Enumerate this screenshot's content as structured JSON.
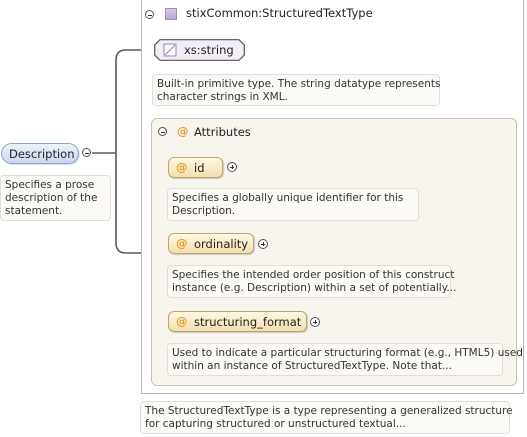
{
  "element": {
    "name": "Description",
    "doc_lines": [
      "Specifies a prose",
      "description of the",
      "statement."
    ]
  },
  "complex_type": {
    "name": "stixCommon:StructuredTextType",
    "doc_lines": [
      "The StructuredTextType is a type representing a generalized structure",
      "for capturing structured or unstructured textual..."
    ]
  },
  "base_type": {
    "name": "xs:string",
    "doc_lines": [
      "Built-in primitive type. The string datatype represents",
      "character strings in XML."
    ]
  },
  "attributes_group": {
    "title": "Attributes",
    "symbol": "@",
    "items": [
      {
        "name": "id",
        "doc_lines": [
          "Specifies a globally unique identifier for this",
          "Description."
        ]
      },
      {
        "name": "ordinality",
        "doc_lines": [
          "Specifies the intended order position of this construct",
          "instance (e.g. Description) within a set of potentially..."
        ]
      },
      {
        "name": "structuring_format",
        "doc_lines": [
          "Used to indicate a particular structuring format (e.g., HTML5) used",
          "within an instance of StructuredTextType. Note that..."
        ]
      }
    ]
  },
  "colors": {
    "element_fill": "#c9d7ee",
    "attribute_fill": "#f2dfae",
    "type_swatch": "#b9a5d0",
    "note_fill": "#fbfaf6",
    "connector": "#555555"
  }
}
